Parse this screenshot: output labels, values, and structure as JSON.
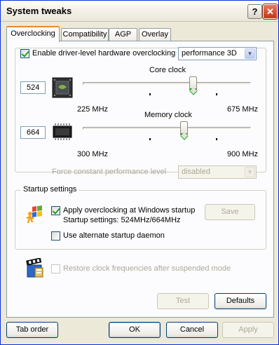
{
  "window": {
    "title": "System tweaks"
  },
  "tabs": [
    {
      "label": "Overclocking",
      "active": true
    },
    {
      "label": "Compatibility"
    },
    {
      "label": "AGP"
    },
    {
      "label": "Overlay"
    }
  ],
  "overclock": {
    "enable_label": "Enable driver-level hardware overclocking",
    "enable_checked": true,
    "profile_value": "performance 3D"
  },
  "core": {
    "title": "Core clock",
    "value": "524",
    "min_label": "225 MHz",
    "max_label": "675 MHz",
    "min": 225,
    "max": 675,
    "current": 524
  },
  "memory": {
    "title": "Memory clock",
    "value": "664",
    "min_label": "300 MHz",
    "max_label": "900 MHz",
    "min": 300,
    "max": 900,
    "current": 664
  },
  "force": {
    "label": "Force constant performance level",
    "value": "disabled"
  },
  "startup": {
    "group_title": "Startup settings",
    "apply_label": "Apply overclocking at Windows startup",
    "apply_checked": true,
    "settings_text": "Startup settings: 524MHz/664MHz",
    "save_label": "Save",
    "alt_daemon_label": "Use alternate startup daemon",
    "alt_daemon_checked": false
  },
  "restore": {
    "label": "Restore clock frequencies after suspended mode",
    "checked": false
  },
  "buttons": {
    "test": "Test",
    "defaults": "Defaults",
    "tab_order": "Tab order",
    "ok": "OK",
    "cancel": "Cancel",
    "apply": "Apply"
  },
  "colors": {
    "titlebar": "#ECE9D8",
    "check_green": "#21A121",
    "tab_highlight": "#E68B2C",
    "close_red": "#C2351A"
  }
}
